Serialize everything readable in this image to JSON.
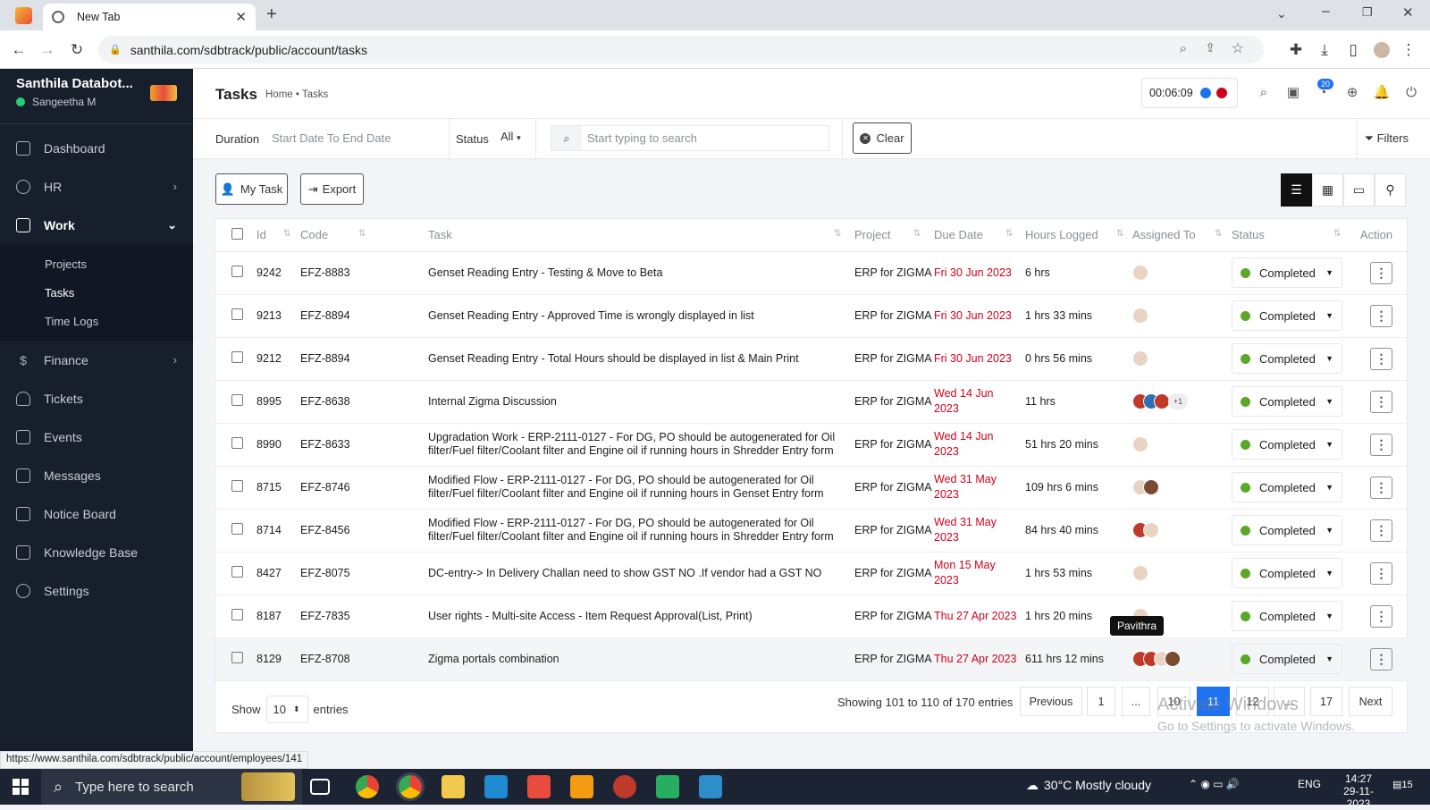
{
  "browser": {
    "tab_title": "New Tab",
    "url": "santhila.com/sdbtrack/public/account/tasks",
    "status_url": "https://www.santhila.com/sdbtrack/public/account/employees/141"
  },
  "sidebar": {
    "company": "Santhila Databot...",
    "user": "Sangeetha M",
    "items": [
      {
        "label": "Dashboard"
      },
      {
        "label": "HR"
      },
      {
        "label": "Work"
      },
      {
        "label": "Finance"
      },
      {
        "label": "Tickets"
      },
      {
        "label": "Events"
      },
      {
        "label": "Messages"
      },
      {
        "label": "Notice Board"
      },
      {
        "label": "Knowledge Base"
      },
      {
        "label": "Settings"
      }
    ],
    "work_sub": [
      "Projects",
      "Tasks",
      "Time Logs"
    ]
  },
  "header": {
    "title": "Tasks",
    "breadcrumb": "Home • Tasks",
    "timer": "00:06:09",
    "notif_count": "20"
  },
  "filters": {
    "duration_label": "Duration",
    "duration_placeholder": "Start Date To End Date",
    "status_label": "Status",
    "status_value": "All",
    "search_placeholder": "Start typing to search",
    "clear_label": "Clear",
    "filters_label": "Filters"
  },
  "actions": {
    "my_task": "My Task",
    "export": "Export"
  },
  "table": {
    "columns": [
      "Id",
      "Code",
      "Task",
      "Project",
      "Due Date",
      "Hours Logged",
      "Assigned To",
      "Status",
      "Action"
    ],
    "rows": [
      {
        "id": "9242",
        "code": "EFZ-8883",
        "task": "Genset Reading Entry - Testing & Move to Beta",
        "project": "ERP for ZIGMA",
        "due": "Fri 30 Jun 2023",
        "hours": "6 hrs",
        "status": "Completed",
        "extra": ""
      },
      {
        "id": "9213",
        "code": "EFZ-8894",
        "task": "Genset Reading Entry - Approved Time is wrongly displayed in list",
        "project": "ERP for ZIGMA",
        "due": "Fri 30 Jun 2023",
        "hours": "1 hrs 33 mins",
        "status": "Completed",
        "extra": ""
      },
      {
        "id": "9212",
        "code": "EFZ-8894",
        "task": "Genset Reading Entry - Total Hours should be displayed in list & Main Print",
        "project": "ERP for ZIGMA",
        "due": "Fri 30 Jun 2023",
        "hours": "0 hrs 56 mins",
        "status": "Completed",
        "extra": ""
      },
      {
        "id": "8995",
        "code": "EFZ-8638",
        "task": "Internal Zigma Discussion",
        "project": "ERP for ZIGMA",
        "due": "Wed 14 Jun 2023",
        "hours": "11 hrs",
        "status": "Completed",
        "extra": "+1"
      },
      {
        "id": "8990",
        "code": "EFZ-8633",
        "task": "Upgradation Work - ERP-2111-0127 - For DG, PO should be autogenerated for Oil filter/Fuel filter/Coolant filter and Engine oil if running hours in Shredder Entry form",
        "project": "ERP for ZIGMA",
        "due": "Wed 14 Jun 2023",
        "hours": "51 hrs 20 mins",
        "status": "Completed",
        "extra": ""
      },
      {
        "id": "8715",
        "code": "EFZ-8746",
        "task": "Modified Flow - ERP-2111-0127 - For DG, PO should be autogenerated for Oil filter/Fuel filter/Coolant filter and Engine oil if running hours in Genset Entry form",
        "project": "ERP for ZIGMA",
        "due": "Wed 31 May 2023",
        "hours": "109 hrs 6 mins",
        "status": "Completed",
        "extra": ""
      },
      {
        "id": "8714",
        "code": "EFZ-8456",
        "task": "Modified Flow - ERP-2111-0127 - For DG, PO should be autogenerated for Oil filter/Fuel filter/Coolant filter and Engine oil if running hours in Shredder Entry form",
        "project": "ERP for ZIGMA",
        "due": "Wed 31 May 2023",
        "hours": "84 hrs 40 mins",
        "status": "Completed",
        "extra": ""
      },
      {
        "id": "8427",
        "code": "EFZ-8075",
        "task": "DC-entry-> In Delivery Challan need to show GST NO .If vendor had a GST NO",
        "project": "ERP for ZIGMA",
        "due": "Mon 15 May 2023",
        "hours": "1 hrs 53 mins",
        "status": "Completed",
        "extra": ""
      },
      {
        "id": "8187",
        "code": "EFZ-7835",
        "task": "User rights - Multi-site Access - Item Request Approval(List, Print)",
        "project": "ERP for ZIGMA",
        "due": "Thu 27 Apr 2023",
        "hours": "1 hrs 20 mins",
        "status": "Completed",
        "extra": ""
      },
      {
        "id": "8129",
        "code": "EFZ-8708",
        "task": "Zigma portals combination",
        "project": "ERP for ZIGMA",
        "due": "Thu 27 Apr 2023",
        "hours": "611 hrs 12 mins",
        "status": "Completed",
        "extra": ""
      }
    ],
    "tooltip": "Pavithra"
  },
  "footer": {
    "show_label": "Show",
    "entries_value": "10",
    "entries_label": "entries",
    "info": "Showing 101 to 110 of 170 entries",
    "pages": [
      "Previous",
      "1",
      "...",
      "10",
      "11",
      "12",
      "...",
      "17",
      "Next"
    ]
  },
  "watermark": {
    "line1": "Activate Windows",
    "line2": "Go to Settings to activate Windows."
  },
  "taskbar": {
    "search_placeholder": "Type here to search",
    "weather": "30°C  Mostly cloudy",
    "lang": "ENG",
    "time": "14:27",
    "date": "29-11-2023",
    "notif": "15"
  },
  "colors": {
    "accent": "#1d72f2",
    "sidebar": "#171f2c",
    "due": "#d0011b",
    "completed": "#5ba829"
  }
}
